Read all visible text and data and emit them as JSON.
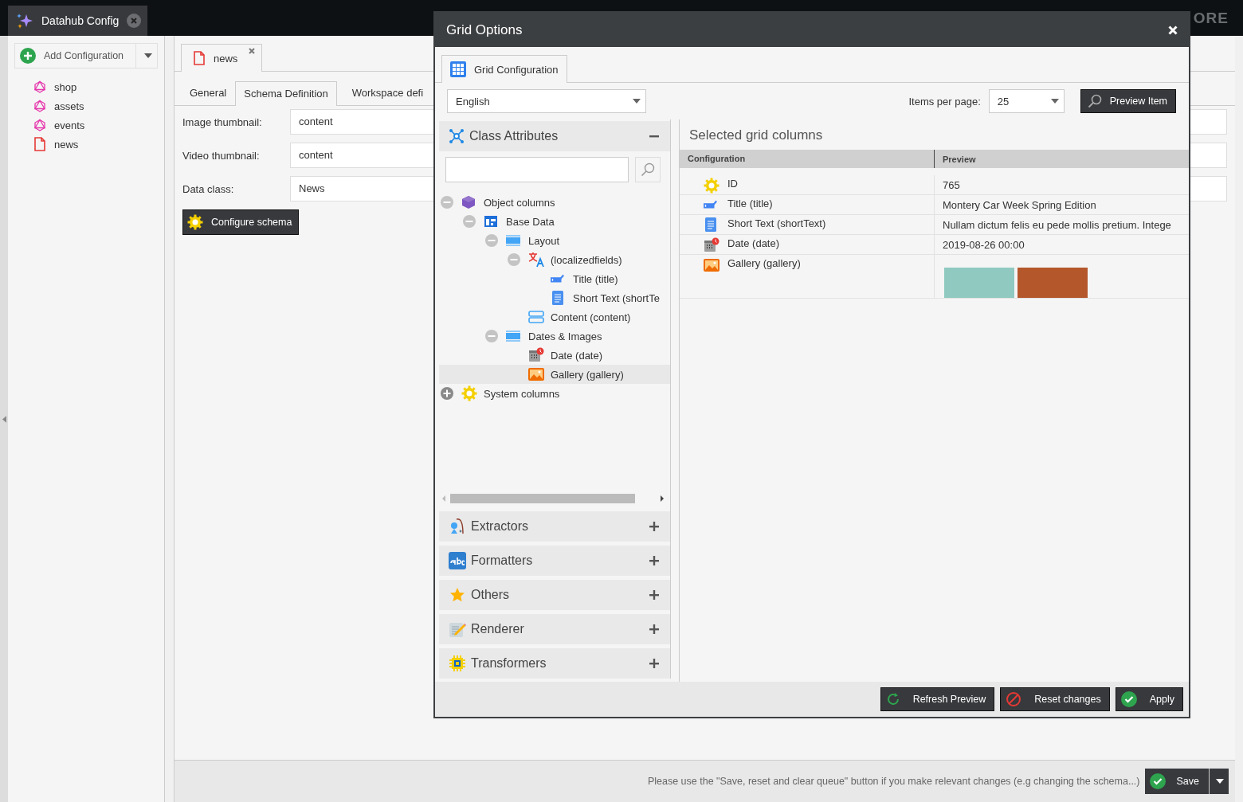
{
  "app_tab": {
    "title": "Datahub Config"
  },
  "logo_text": "ORE",
  "sidebar": {
    "add_button": "Add Configuration",
    "items": [
      {
        "label": "shop",
        "kind": "graphql",
        "selected": false
      },
      {
        "label": "assets",
        "kind": "graphql",
        "selected": false
      },
      {
        "label": "events",
        "kind": "graphql",
        "selected": false
      },
      {
        "label": "news",
        "kind": "document",
        "selected": false
      }
    ]
  },
  "editor_tab": {
    "title": "news"
  },
  "subtabs": [
    {
      "label": "General",
      "selected": false
    },
    {
      "label": "Schema Definition",
      "selected": true
    },
    {
      "label": "Workspace defi",
      "selected": false
    }
  ],
  "form": [
    {
      "label": "Image thumbnail:",
      "value": "content"
    },
    {
      "label": "Video thumbnail:",
      "value": "content"
    },
    {
      "label": "Data class:",
      "value": "News"
    }
  ],
  "configure_button": "Configure schema",
  "footer": {
    "message": "Please use the \"Save, reset and clear queue\" button if you make relevant changes (e.g changing the schema...)",
    "save_button": "Save"
  },
  "dialog": {
    "title": "Grid Options",
    "tab": {
      "label": "Grid Configuration",
      "selected": true
    },
    "language": "English",
    "items_per_page_label": "Items per page:",
    "items_per_page": "25",
    "preview_button": "Preview Item",
    "panels": [
      {
        "title": "Class Attributes",
        "kind": "attributes",
        "expanded": true
      },
      {
        "title": "Extractors",
        "kind": "extractors",
        "expanded": false
      },
      {
        "title": "Formatters",
        "kind": "formatters",
        "expanded": false
      },
      {
        "title": "Others",
        "kind": "others",
        "expanded": false
      },
      {
        "title": "Renderer",
        "kind": "renderer",
        "expanded": false
      },
      {
        "title": "Transformers",
        "kind": "transformers",
        "expanded": false
      }
    ],
    "tree": [
      {
        "label": "Object columns",
        "kind": "object",
        "expanded": true,
        "selected": false,
        "children": [
          {
            "label": "Base Data",
            "kind": "panel",
            "expanded": true,
            "selected": false,
            "children": [
              {
                "label": "Layout",
                "kind": "layout",
                "expanded": true,
                "selected": false,
                "children": [
                  {
                    "label": "(localizedfields)",
                    "kind": "localized",
                    "expanded": true,
                    "selected": false,
                    "children": [
                      {
                        "label": "Title (title)",
                        "kind": "input",
                        "selected": false
                      },
                      {
                        "label": "Short Text (shortTe",
                        "kind": "textarea",
                        "selected": false
                      }
                    ]
                  },
                  {
                    "label": "Content (content)",
                    "kind": "content",
                    "selected": false
                  }
                ]
              },
              {
                "label": "Dates & Images",
                "kind": "layout",
                "expanded": true,
                "selected": false,
                "children": [
                  {
                    "label": "Date (date)",
                    "kind": "date",
                    "selected": false
                  },
                  {
                    "label": "Gallery (gallery)",
                    "kind": "image",
                    "selected": true
                  }
                ]
              }
            ]
          }
        ]
      },
      {
        "label": "System columns",
        "kind": "system",
        "expanded": false,
        "selected": false
      }
    ],
    "selected_heading": "Selected grid columns",
    "columns": [
      "Configuration",
      "Preview"
    ],
    "rows": [
      {
        "kind": "system",
        "config": "ID",
        "preview": "765"
      },
      {
        "kind": "input",
        "config": "Title (title)",
        "preview": "Montery Car Week Spring Edition"
      },
      {
        "kind": "textarea",
        "config": "Short Text (shortText)",
        "preview": "Nullam dictum felis eu pede mollis pretium. Intege"
      },
      {
        "kind": "date",
        "config": "Date (date)",
        "preview": "2019-08-26 00:00"
      },
      {
        "kind": "gallery",
        "config": "Gallery (gallery)"
      }
    ],
    "buttons": [
      {
        "label": "Refresh Preview",
        "kind": "refresh"
      },
      {
        "label": "Reset changes",
        "kind": "reset"
      },
      {
        "label": "Apply",
        "kind": "apply"
      }
    ]
  }
}
